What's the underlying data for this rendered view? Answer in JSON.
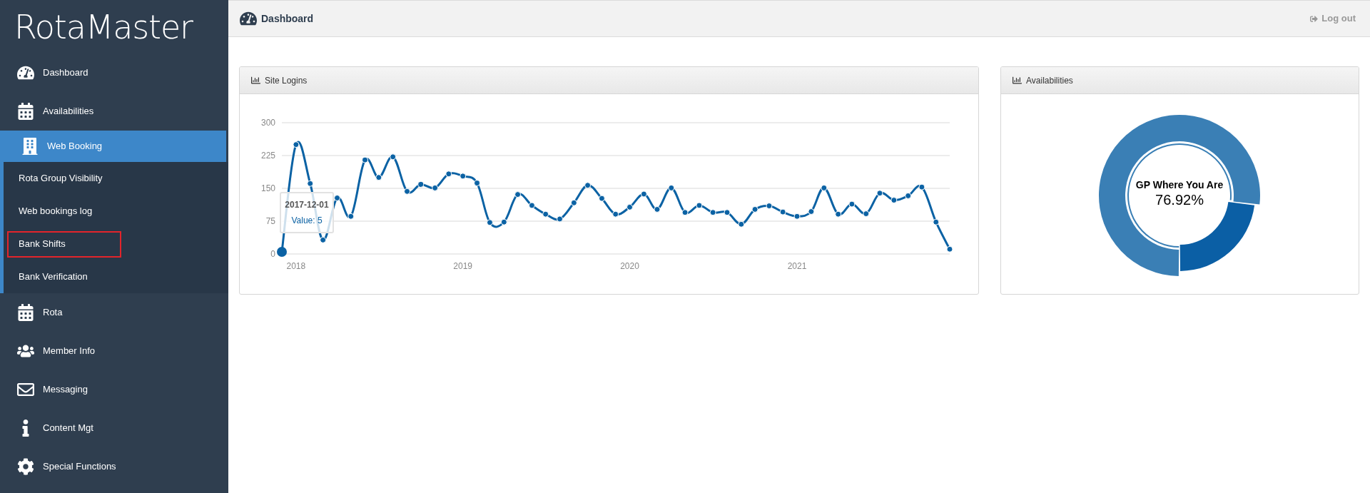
{
  "sidebar": {
    "logo": "RotaMaster",
    "items": [
      {
        "label": "Dashboard",
        "kind": "gauge",
        "selected": false
      },
      {
        "label": "Availabilities",
        "kind": "calendar",
        "selected": false
      },
      {
        "label": "Web Booking",
        "kind": "building",
        "selected": true,
        "children": [
          {
            "label": "Rota Group Visibility",
            "highlighted": false
          },
          {
            "label": "Web bookings log",
            "highlighted": false
          },
          {
            "label": "Bank Shifts",
            "highlighted": true
          },
          {
            "label": "Bank Verification",
            "highlighted": false
          }
        ]
      },
      {
        "label": "Rota",
        "kind": "calendar",
        "selected": false
      },
      {
        "label": "Member Info",
        "kind": "users",
        "selected": false
      },
      {
        "label": "Messaging",
        "kind": "mail",
        "selected": false
      },
      {
        "label": "Content Mgt",
        "kind": "info",
        "selected": false
      },
      {
        "label": "Special Functions",
        "kind": "gear",
        "selected": false
      }
    ]
  },
  "header": {
    "title": "Dashboard",
    "logout": "Log out"
  },
  "panels": [
    {
      "title": "Site Logins",
      "tooltip": {
        "date": "2017-12-01",
        "value": "Value: 5"
      },
      "chart_data": {
        "type": "line",
        "x": [
          "2017-12-01",
          "2018-01-01",
          "2018-02-01",
          "2018-03-01",
          "2018-04-01",
          "2018-05-01",
          "2018-06-01",
          "2018-07-01",
          "2018-08-01",
          "2018-09-01",
          "2018-10-01",
          "2018-11-01",
          "2018-12-01",
          "2019-01-01",
          "2019-02-01",
          "2019-03-01",
          "2019-04-01",
          "2019-05-01",
          "2019-06-01",
          "2019-07-01",
          "2019-08-01",
          "2019-09-01",
          "2019-10-01",
          "2019-11-01",
          "2019-12-01",
          "2020-01-01",
          "2020-02-01",
          "2020-03-01",
          "2020-04-01",
          "2020-05-01",
          "2020-06-01",
          "2020-07-01",
          "2020-08-01",
          "2020-09-01",
          "2020-10-01",
          "2020-11-01",
          "2020-12-01",
          "2021-01-01",
          "2021-02-01",
          "2021-03-01",
          "2021-04-01",
          "2021-05-01",
          "2021-06-01",
          "2021-07-01",
          "2021-08-01",
          "2021-09-01",
          "2021-10-01",
          "2021-11-01",
          "2021-12-01"
        ],
        "series": [
          {
            "color": "#0b62a4",
            "marker": "circle",
            "values": [
              5,
              250,
              161,
              32,
              128,
              86,
              215,
              175,
              222,
              143,
              159,
              151,
              183,
              178,
              162,
              72,
              73,
              136,
              111,
              91,
              80,
              117,
              157,
              127,
              91,
              107,
              137,
              102,
              151,
              95,
              111,
              95,
              95,
              68,
              102,
              110,
              96,
              86,
              97,
              151,
              91,
              114,
              92,
              139,
              123,
              133,
              153,
              73,
              11
            ]
          }
        ],
        "xlim": [
          "2017-12-01",
          "2021-12-01"
        ],
        "grid": true,
        "ylim": [
          0,
          300
        ],
        "yticks": [
          0,
          75,
          150,
          225,
          300
        ],
        "xticks": [
          {
            "value": "2018-01-01",
            "label": "2018"
          },
          {
            "value": "2019-01-01",
            "label": "2019"
          },
          {
            "value": "2020-01-01",
            "label": "2020"
          },
          {
            "value": "2021-01-01",
            "label": "2021"
          }
        ]
      }
    },
    {
      "title": "Availabilities",
      "center_label": "GP Where You Are",
      "center_value": "76.92%",
      "chart_data": {
        "type": "donut",
        "values": [
          76.92,
          23.08
        ],
        "colors": [
          "#3a7fb5",
          "#0b5fa5"
        ]
      }
    }
  ]
}
